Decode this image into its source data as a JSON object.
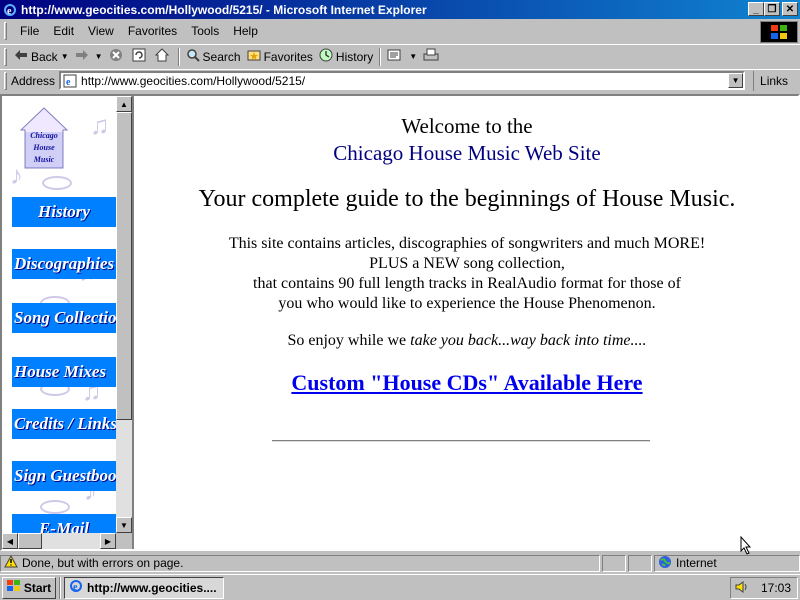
{
  "window": {
    "title": "http://www.geocities.com/Hollywood/5215/ - Microsoft Internet Explorer",
    "min_icon": "minimize-icon",
    "max_icon": "restore-icon",
    "close_icon": "close-icon"
  },
  "menu": [
    "File",
    "Edit",
    "View",
    "Favorites",
    "Tools",
    "Help"
  ],
  "toolbar": {
    "back": "Back",
    "search": "Search",
    "favorites": "Favorites",
    "history": "History"
  },
  "address": {
    "label": "Address",
    "value": "http://www.geocities.com/Hollywood/5215/",
    "links": "Links"
  },
  "nav": {
    "logo_text": [
      "Chicago",
      "House",
      "Music"
    ],
    "items": [
      {
        "label": "History"
      },
      {
        "label": "Discographies"
      },
      {
        "label": "Song Collection"
      },
      {
        "label": "House Mixes"
      },
      {
        "label": "Credits / Links"
      },
      {
        "label": "Sign Guestbook"
      },
      {
        "label": "E-Mail"
      }
    ]
  },
  "main": {
    "welcome": "Welcome to the",
    "site_name": "Chicago House Music Web Site",
    "tagline": "Your complete guide to the beginnings of House Music.",
    "para_lines": [
      "This site contains articles, discographies of songwriters and much MORE!",
      "PLUS a NEW song collection,",
      "that contains 90 full length tracks in RealAudio format for those of",
      "you who would like to experience the House Phenomenon."
    ],
    "enjoy_prefix": "So enjoy while we ",
    "enjoy_italic": "take you back...way back into time....",
    "cta_link": "Custom \"House CDs\" Available Here"
  },
  "status": {
    "text": "Done, but with errors on page.",
    "zone": "Internet"
  },
  "taskbar": {
    "start": "Start",
    "task": "http://www.geocities....",
    "clock": "17:03"
  },
  "colors": {
    "titlebar_start": "#000080",
    "titlebar_end": "#1084d0",
    "nav_button": "#0080ff",
    "site_name": "#000080",
    "link": "#0000ee"
  }
}
